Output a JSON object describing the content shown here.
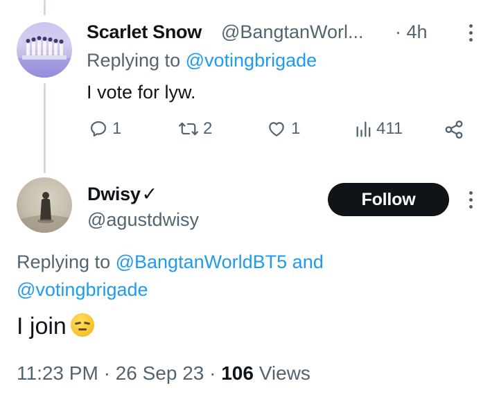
{
  "reply_tweet": {
    "display_name": "Scarlet Snow",
    "handle": "@BangtanWorl...",
    "time": "· 4h",
    "replying_to_prefix": "Replying to",
    "replying_to_handle": "@votingbrigade",
    "text": "I vote for lyw.",
    "actions": {
      "replies": "1",
      "retweets": "2",
      "likes": "1",
      "views": "411"
    }
  },
  "main_tweet": {
    "display_name": "Dwisy",
    "verified_mark": "✓",
    "handle": "@agustdwisy",
    "follow_label": "Follow",
    "replying_to_prefix": "Replying to",
    "replying_to_handle_1": "@BangtanWorldBT5",
    "replying_to_and": "and",
    "replying_to_handle_2": "@votingbrigade",
    "text": "I join",
    "emoji": "pensive-face",
    "meta": {
      "time": "11:23 PM",
      "sep1": "·",
      "date": "26 Sep 23",
      "sep2": "·",
      "views_count": "106",
      "views_label": "Views"
    }
  },
  "colors": {
    "link": "#1d9bf0",
    "secondary_text": "#536471",
    "primary_text": "#0f1419",
    "follow_bg": "#0f1419",
    "thread_line": "#cfd9de"
  }
}
